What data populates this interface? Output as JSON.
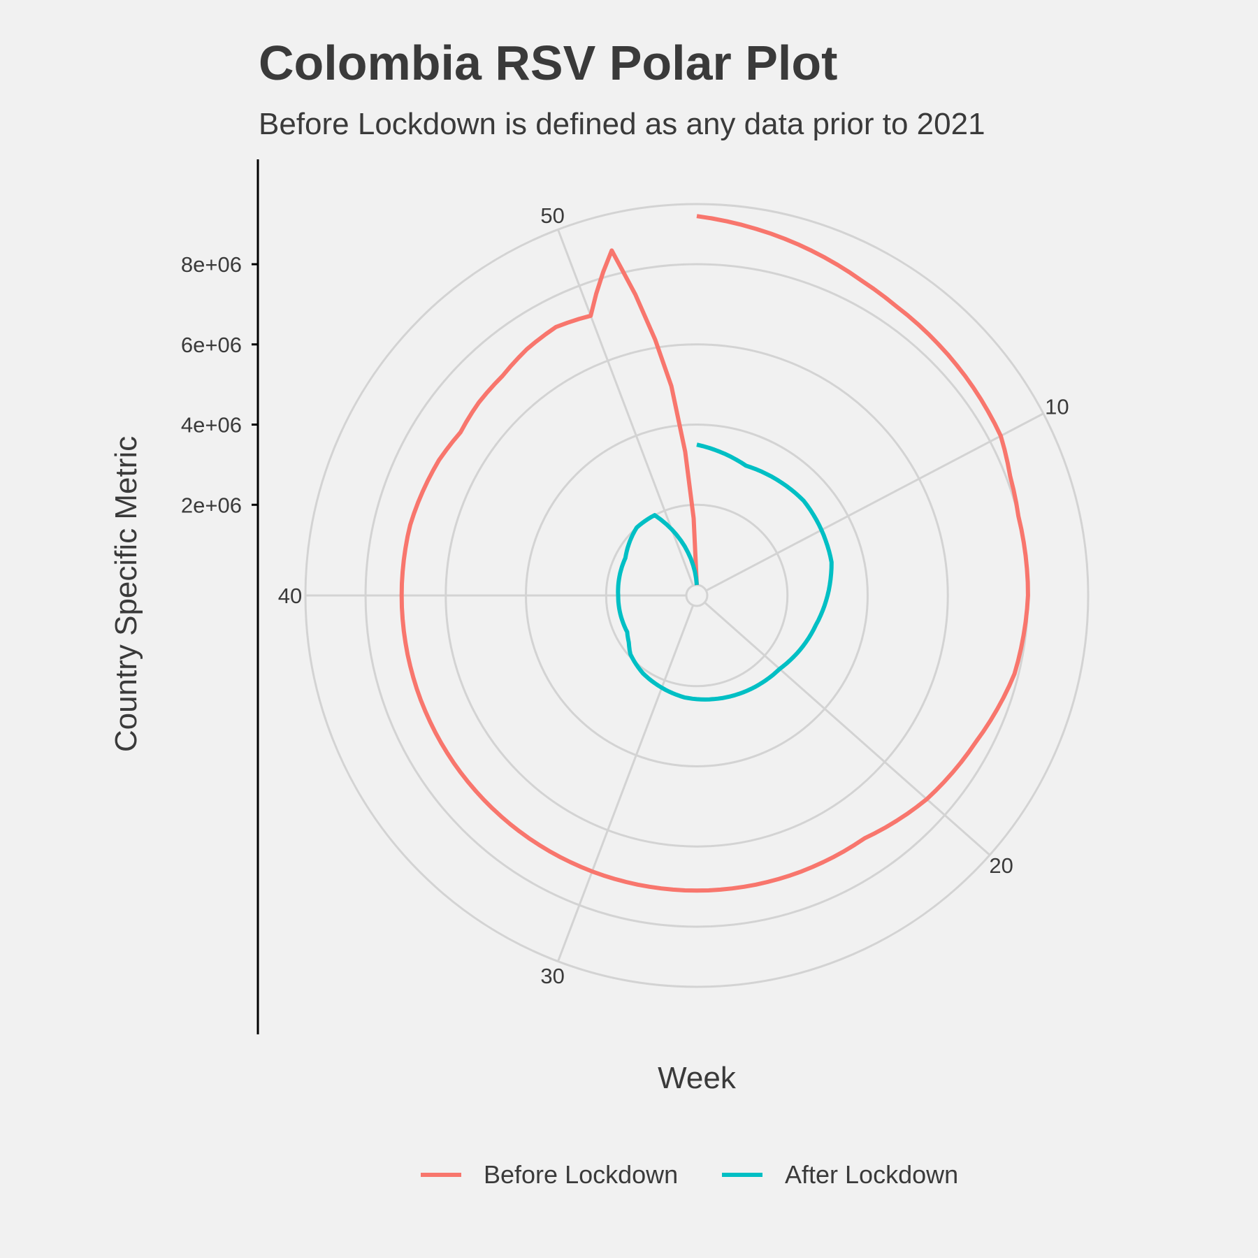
{
  "chart_data": {
    "type": "line",
    "coord": "polar",
    "title": "Colombia RSV Polar Plot",
    "subtitle": "Before Lockdown is defined as any data prior to 2021",
    "xlabel": "Week",
    "ylabel": "Country Specific Metric",
    "x_ticks": [
      10,
      20,
      30,
      40,
      50
    ],
    "y_ticks": [
      2000000,
      4000000,
      6000000,
      8000000
    ],
    "y_tick_labels": [
      "2e+06",
      "4e+06",
      "6e+06",
      "8e+06"
    ],
    "xlim": [
      1,
      53
    ],
    "grid": true,
    "legend_position": "bottom",
    "series": [
      {
        "name": "Before Lockdown",
        "color": "#F8766D",
        "x": [
          1,
          5,
          6,
          8,
          10,
          11,
          12,
          14,
          16,
          18,
          20,
          22,
          26,
          30,
          34,
          38,
          40,
          42,
          44,
          45,
          46,
          47,
          48,
          49,
          50,
          51,
          52,
          53
        ],
        "y": [
          9200000,
          8600000,
          8500000,
          8400000,
          8300000,
          8100000,
          8000000,
          8000000,
          7900000,
          7600000,
          7400000,
          7100000,
          7100000,
          7100000,
          7100000,
          7100000,
          7100000,
          7100000,
          7000000,
          6900000,
          7000000,
          7050000,
          7200000,
          7300000,
          7200000,
          8600000,
          5000000,
          0
        ]
      },
      {
        "name": "After Lockdown",
        "color": "#00BFC4",
        "x": [
          1,
          2,
          4,
          8,
          12,
          16,
          20,
          24,
          28,
          32,
          34,
          35,
          36,
          40,
          44,
          47,
          49,
          53
        ],
        "y": [
          3500000,
          3400000,
          3200000,
          3300000,
          3200000,
          2800000,
          2500000,
          2400000,
          2300000,
          2100000,
          1950000,
          1800000,
          1700000,
          1700000,
          1750000,
          2000000,
          2000000,
          0
        ]
      }
    ]
  }
}
